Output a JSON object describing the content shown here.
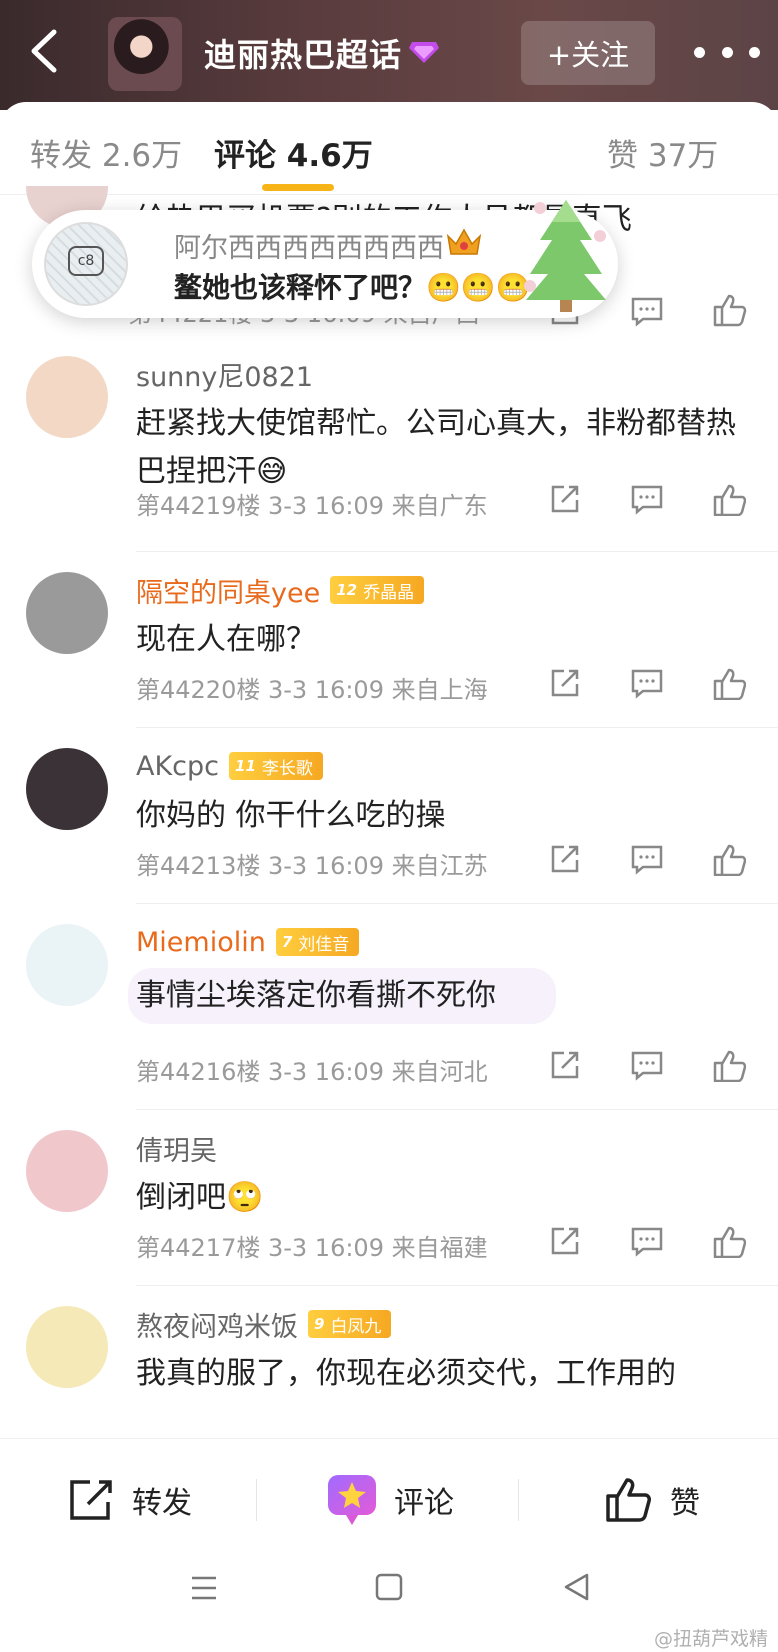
{
  "header": {
    "topic_title": "迪丽热巴超话",
    "follow_label": "+关注",
    "gem_color": "#b04ce0"
  },
  "tabs": [
    {
      "label": "转发 2.6万"
    },
    {
      "label": "评论 4.6万"
    },
    {
      "label": "赞 37万"
    }
  ],
  "popup": {
    "name": "阿尔西西西西西西西西",
    "text": "鳌她也该释怀了吧？😬😬😬",
    "avatar_text": "c8"
  },
  "partial_top": {
    "text": "给热巴买机票?别的工作人员都是直飞",
    "meta": "第44221楼 3-3 16:09 来自广西"
  },
  "comments": [
    {
      "name": "sunny尼0821",
      "name_style": "gray",
      "text": "赶紧找大使馆帮忙。公司心真大，非粉都替热巴捏把汗😅",
      "meta": "第44219楼 3-3 16:09 来自广东",
      "avatar_color": "#f3d9c5"
    },
    {
      "name": "隔空的同桌yee",
      "name_style": "orange",
      "badge_level": "12",
      "badge_name": "乔晶晶",
      "text": "现在人在哪？",
      "meta": "第44220楼 3-3 16:09 来自上海",
      "avatar_color": "#9a9a9a"
    },
    {
      "name": "AKcpc",
      "name_style": "gray",
      "badge_level": "11",
      "badge_name": "李长歌",
      "text": "你妈的 你干什么吃的操",
      "meta": "第44213楼 3-3 16:09 来自江苏",
      "avatar_color": "#3a3236"
    },
    {
      "name": "Miemiolin",
      "name_style": "orange",
      "badge_level": "7",
      "badge_name": "刘佳音",
      "text": "事情尘埃落定你看撕不死你",
      "meta": "第44216楼 3-3 16:09 来自河北",
      "avatar_color": "#eaf4f6"
    },
    {
      "name": "倩玥吴",
      "name_style": "gray",
      "text": "倒闭吧🙄",
      "meta": "第44217楼 3-3 16:09 来自福建",
      "avatar_color": "#f0c8cc"
    },
    {
      "name": "熬夜闷鸡米饭",
      "name_style": "gray",
      "badge_level": "9",
      "badge_name": "白凤九",
      "text": "我真的服了，你现在必须交代，工作用的",
      "meta": "",
      "avatar_color": "#f5e9b8"
    }
  ],
  "bottom_bar": {
    "repost_label": "转发",
    "comment_label": "评论",
    "like_label": "赞"
  },
  "watermark": "@扭葫芦戏精"
}
